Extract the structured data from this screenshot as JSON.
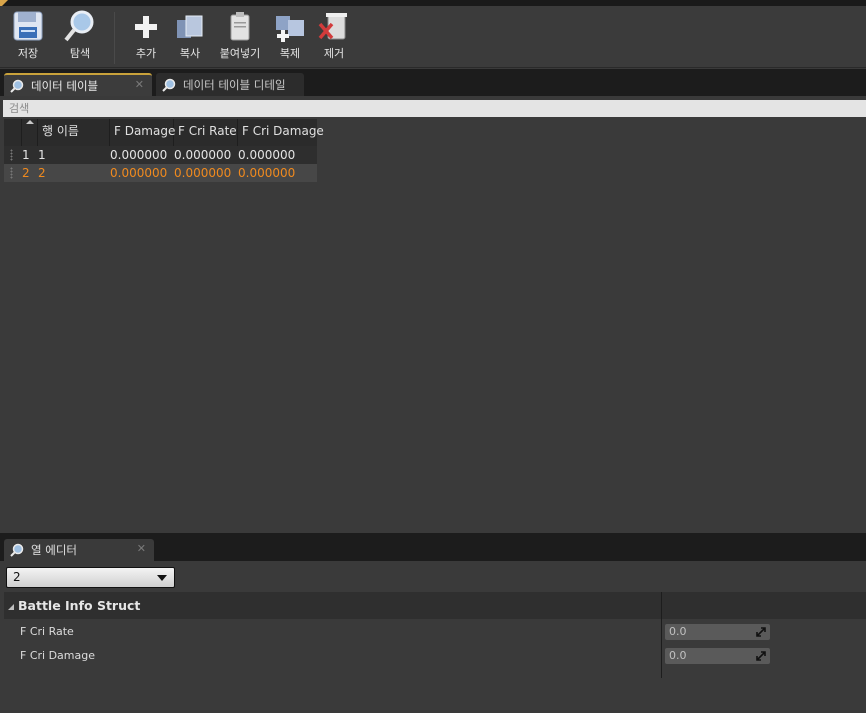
{
  "toolbar": {
    "save": "저장",
    "browse": "탐색",
    "add": "추가",
    "copy": "복사",
    "paste": "붙여넣기",
    "duplicate": "복제",
    "remove": "제거"
  },
  "tabs": [
    {
      "label": "데이터 테이블"
    },
    {
      "label": "데이터 테이블 디테일"
    }
  ],
  "search": {
    "placeholder": "검색"
  },
  "table": {
    "headers": [
      "행 이름",
      "F Damage",
      "F Cri Rate",
      "F Cri Damage"
    ],
    "rows": [
      {
        "index": "1",
        "name": "1",
        "f_damage": "0.000000",
        "f_cri_rate": "0.000000",
        "f_cri_damage": "0.000000"
      },
      {
        "index": "2",
        "name": "2",
        "f_damage": "0.000000",
        "f_cri_rate": "0.000000",
        "f_cri_damage": "0.000000"
      }
    ]
  },
  "row_editor": {
    "tab_label": "열 에디터",
    "selected_row": "2",
    "struct_name": "Battle Info Struct",
    "properties": [
      {
        "label": "F Cri Rate",
        "value": "0.0"
      },
      {
        "label": "F Cri Damage",
        "value": "0.0"
      }
    ]
  },
  "colors": {
    "selected_row_text": "#f08a1e",
    "active_tab_accent": "#c9a23b",
    "panel_bg": "#3a3a3a"
  }
}
